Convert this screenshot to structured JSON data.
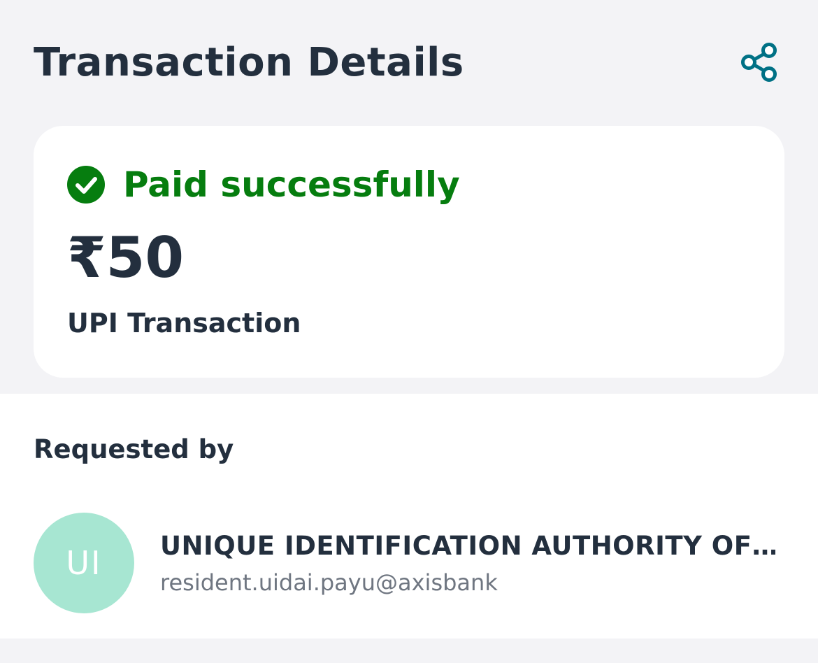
{
  "header": {
    "title": "Transaction Details",
    "share_icon": "share-icon",
    "accent_color": "#007185"
  },
  "status_card": {
    "status_text": "Paid successfully",
    "status_icon": "check-circle-icon",
    "status_color": "#067d0f",
    "amount": "₹50",
    "transaction_type": "UPI Transaction"
  },
  "requested_by": {
    "section_label": "Requested by",
    "avatar_initials": "UI",
    "avatar_color": "#a7e6d2",
    "payee_name": "UNIQUE IDENTIFICATION AUTHORITY OF…",
    "payee_vpa": "resident.uidai.payu@axisbank"
  }
}
